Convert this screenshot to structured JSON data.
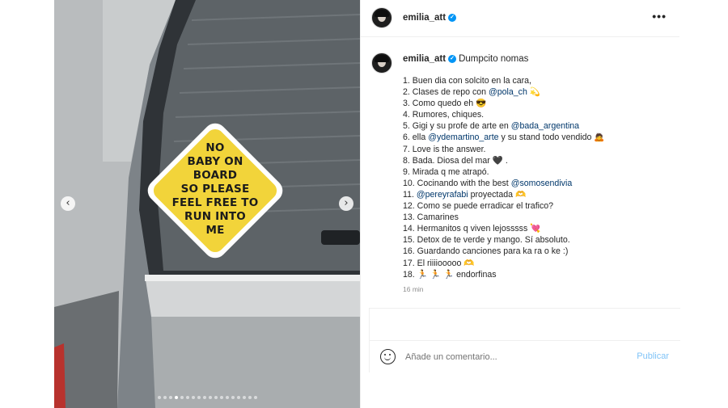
{
  "post": {
    "username": "emilia_att",
    "verified_mark": "✓",
    "more_icon": "•••",
    "caption_title": "Dumpcito nomas",
    "time": "16 min"
  },
  "sticker": {
    "lines": [
      "NO",
      "BABY ON",
      "BOARD",
      "SO PLEASE",
      "FEEL FREE TO",
      "RUN INTO",
      "ME"
    ]
  },
  "carousel": {
    "prev_label": "‹",
    "next_label": "›",
    "total_slides": 18,
    "current_slide": 4
  },
  "caption_lines": [
    [
      {
        "t": "1. Buen dia con solcito en la cara,"
      }
    ],
    [
      {
        "t": "2. Clases de repo con "
      },
      {
        "t": "@pola_ch",
        "m": true
      },
      {
        "t": " 💫"
      }
    ],
    [
      {
        "t": "3. Como quedo eh 😎"
      }
    ],
    [
      {
        "t": "4. Rumores, chiques."
      }
    ],
    [
      {
        "t": "5. Gigi y su profe de arte en "
      },
      {
        "t": "@bada_argentina",
        "m": true
      }
    ],
    [
      {
        "t": "6. ella "
      },
      {
        "t": "@ydemartino_arte",
        "m": true
      },
      {
        "t": " y su stand todo vendido 🙇"
      }
    ],
    [
      {
        "t": "7. Love is the answer."
      }
    ],
    [
      {
        "t": "8. Bada. Diosa del mar 🖤 ."
      }
    ],
    [
      {
        "t": "9. Mirada q me atrapó."
      }
    ],
    [
      {
        "t": "10. Cocinando with the best "
      },
      {
        "t": "@somosendivia",
        "m": true
      }
    ],
    [
      {
        "t": "11. "
      },
      {
        "t": "@pereyrafabi",
        "m": true
      },
      {
        "t": " proyectada 🫶"
      }
    ],
    [
      {
        "t": "12. Como se puede erradicar el trafico?"
      }
    ],
    [
      {
        "t": "13. Camarines"
      }
    ],
    [
      {
        "t": "14. Hermanitos q viven lejosssss 💘"
      }
    ],
    [
      {
        "t": "15. Detox de te verde y mango. Sí absoluto."
      }
    ],
    [
      {
        "t": "16. Guardando canciones para ka ra o ke :)"
      }
    ],
    [
      {
        "t": "17. El riiiiooooo 🫶"
      }
    ],
    [
      {
        "t": "18. 🏃 🏃 🏃 endorfinas"
      }
    ]
  ],
  "comment": {
    "placeholder": "Añade un comentario...",
    "publish_label": "Publicar"
  },
  "colors": {
    "mention": "#00376b",
    "verified": "#0095f6",
    "publish": "#7fc3f7",
    "sticker": "#f2d43a"
  }
}
